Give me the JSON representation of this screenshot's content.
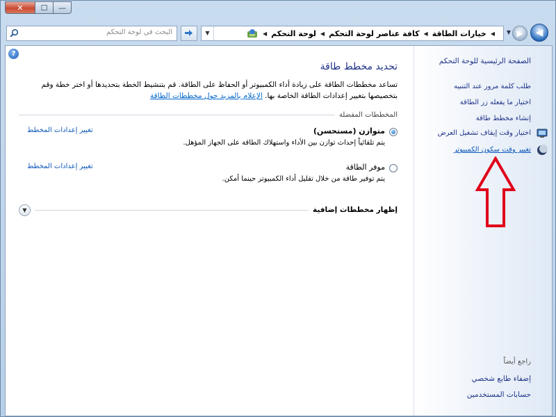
{
  "window": {
    "caption_close": "✕",
    "caption_maximize": "☐",
    "caption_minimize": "—"
  },
  "navbar": {
    "search_placeholder": "البحث في لوحة التحكم",
    "breadcrumbs": [
      "لوحة التحكم",
      "كافة عناصر لوحة التحكم",
      "خيارات الطاقة"
    ],
    "separator": "◀"
  },
  "main": {
    "title": "تحديد مخطط طاقة",
    "intro_text": "تساعد مخططات الطاقة على زيادة أداء الكمبيوتر أو الحفاظ على الطاقة. قم بتنشيط الخطة بتحديدها أو اختر خطة وقم بتخصيصها بتغيير إعدادات الطاقة الخاصة بها.",
    "intro_link": "الإعلام بالمزيد حول مخططات الطاقة",
    "section_label": "المخططات المفضلة",
    "plans": [
      {
        "name": "متوازن (مستحسن)",
        "description": "يتم تلقائياً إحداث توازن بين الأداء واستهلاك الطاقة على الجهاز المؤهل.",
        "change_link": "تغيير إعدادات المخطط",
        "selected": true
      },
      {
        "name": "موفر الطاقة",
        "description": "يتم توفير طاقة من خلال تقليل أداء الكمبيوتر حينما أمكن.",
        "change_link": "تغيير إعدادات المخطط",
        "selected": false
      }
    ],
    "show_more_label": "إظهار مخططات إضافية"
  },
  "sidebar": {
    "home": "الصفحة الرئيسية للوحة التحكم",
    "links": [
      "طلب كلمة مرور عند التنبيه",
      "اختيار ما يفعله زر الطاقة",
      "إنشاء مخطط طاقة",
      "اختيار وقت إيقاف تشغيل العرض",
      "تغيير وقت سكون الكمبيوتر"
    ],
    "see_also": "راجع أيضاً",
    "see_also_links": [
      "إضفاء طابع شخصي",
      "حسابات المستخدمين"
    ]
  },
  "colors": {
    "link": "#0b56b8",
    "title": "#1e3287",
    "arrow": "#e0001a"
  }
}
